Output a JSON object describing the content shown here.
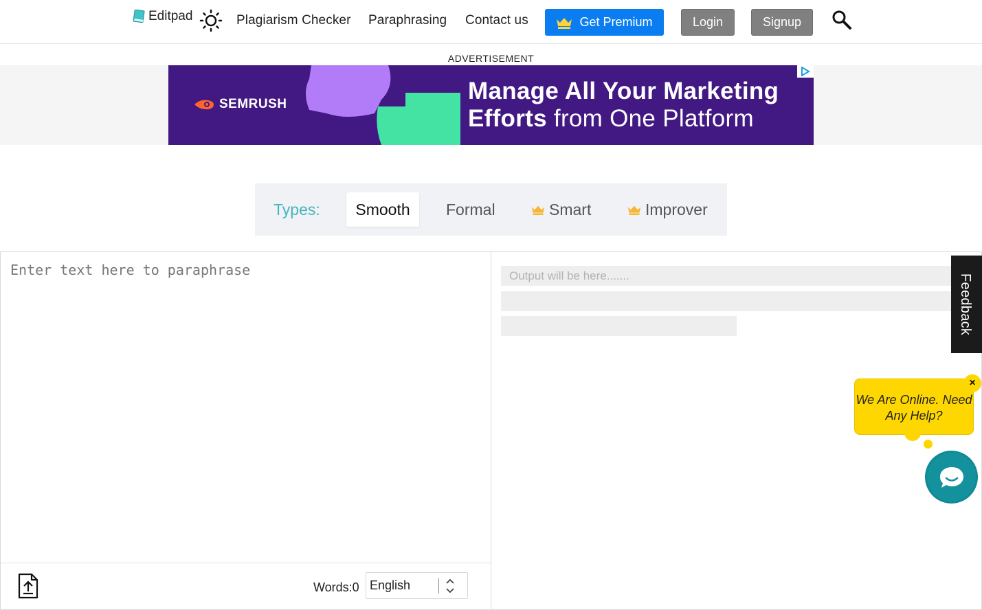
{
  "header": {
    "brand": "Editpad",
    "nav": [
      "Plagiarism Checker",
      "Paraphrasing",
      "Contact us"
    ],
    "premium_label": "Get Premium",
    "login_label": "Login",
    "signup_label": "Signup"
  },
  "ad": {
    "label": "ADVERTISEMENT",
    "brand": "SEMRUSH",
    "headline_line1": "Manage All Your Marketing",
    "headline_line2_bold": "Efforts",
    "headline_line2_rest": " from One Platform"
  },
  "types": {
    "label": "Types:",
    "tabs": [
      {
        "label": "Smooth",
        "premium": false,
        "active": true
      },
      {
        "label": "Formal",
        "premium": false,
        "active": false
      },
      {
        "label": "Smart",
        "premium": true,
        "active": false
      },
      {
        "label": "Improver",
        "premium": true,
        "active": false
      }
    ]
  },
  "input": {
    "placeholder": "Enter text here to paraphrase",
    "words_label": "Words:0",
    "language": "English"
  },
  "output": {
    "placeholder": "Output will be here......."
  },
  "feedback": {
    "label": "Feedback"
  },
  "chat": {
    "line1": "We Are Online. Need",
    "line2": "Any Help?",
    "close_label": "×"
  },
  "colors": {
    "premium_blue": "#0a7ef1",
    "ad_purple": "#421983",
    "types_teal": "#46b5be",
    "chat_yellow": "#ffd700",
    "chat_teal": "#13919d"
  }
}
